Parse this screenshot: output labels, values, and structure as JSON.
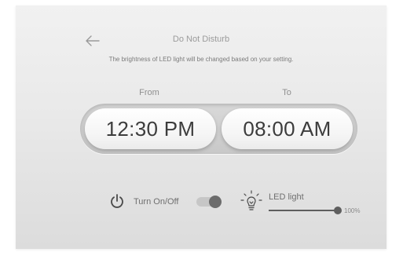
{
  "header": {
    "title": "Do Not Disturb",
    "subtitle": "The brightness of LED light will be changed based on your setting."
  },
  "schedule": {
    "from_label": "From",
    "to_label": "To",
    "from_time": "12:30 PM",
    "to_time": "08:00 AM"
  },
  "controls": {
    "toggle_label": "Turn On/Off",
    "toggle_on": true,
    "led_label": "LED light",
    "led_level": 100,
    "led_level_text": "100%"
  },
  "icons": {
    "back": "arrow-left-icon",
    "power": "power-icon",
    "bulb": "light-bulb-icon"
  },
  "colors": {
    "accent": "#5e5e5e",
    "text_dark": "#3c3c3c"
  }
}
